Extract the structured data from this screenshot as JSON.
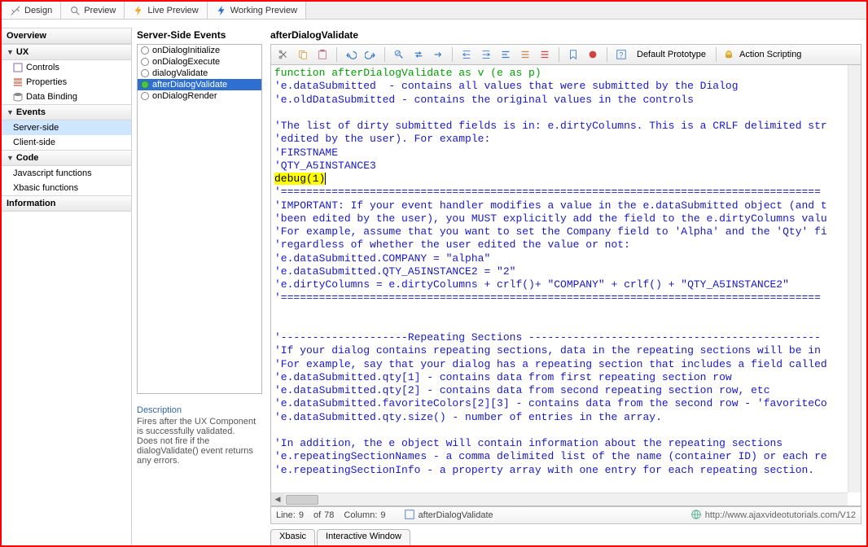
{
  "topTabs": [
    {
      "label": "Design",
      "icon": "design"
    },
    {
      "label": "Preview",
      "icon": "preview"
    },
    {
      "label": "Live Preview",
      "icon": "bolt-orange"
    },
    {
      "label": "Working Preview",
      "icon": "bolt-blue"
    }
  ],
  "leftNav": {
    "groups": [
      {
        "label": "Overview",
        "collapsible": false,
        "items": []
      },
      {
        "label": "UX",
        "collapsible": true,
        "items": [
          {
            "label": "Controls",
            "icon": "controls"
          },
          {
            "label": "Properties",
            "icon": "props"
          },
          {
            "label": "Data Binding",
            "icon": "db"
          }
        ]
      },
      {
        "label": "Events",
        "collapsible": true,
        "items": [
          {
            "label": "Server-side",
            "selected": true
          },
          {
            "label": "Client-side"
          }
        ]
      },
      {
        "label": "Code",
        "collapsible": true,
        "items": [
          {
            "label": "Javascript functions"
          },
          {
            "label": "Xbasic functions"
          }
        ]
      },
      {
        "label": "Information",
        "collapsible": false,
        "items": []
      }
    ]
  },
  "midPanel": {
    "title": "Server-Side Events",
    "events": [
      {
        "label": "onDialogInitialize",
        "defined": false
      },
      {
        "label": "onDialogExecute",
        "defined": false
      },
      {
        "label": "dialogValidate",
        "defined": false
      },
      {
        "label": "afterDialogValidate",
        "defined": true,
        "selected": true
      },
      {
        "label": "onDialogRender",
        "defined": false
      }
    ],
    "descriptionTitle": "Description",
    "descriptionBody": "Fires after the UX Component is successfully validated. Does not fire if the dialogValidate() event returns any errors."
  },
  "rightPanel": {
    "title": "afterDialogValidate",
    "toolbar": {
      "defaultProto": "Default Prototype",
      "actionScripting": "Action Scripting"
    },
    "code": {
      "fnDecl": "function afterDialogValidate as v (e as p)",
      "lines": [
        "'e.dataSubmitted  - contains all values that were submitted by the Dialog",
        "'e.oldDataSubmitted - contains the original values in the controls",
        "",
        "'The list of dirty submitted fields is in: e.dirtyColumns. This is a CRLF delimited str",
        "'edited by the user). For example:",
        "'FIRSTNAME",
        "'QTY_A5INSTANCE3"
      ],
      "highlight": "debug(1)",
      "divider": "'=====================================================================================",
      "lines2": [
        "'IMPORTANT: If your event handler modifies a value in the e.dataSubmitted object (and t",
        "'been edited by the user), you MUST explicitly add the field to the e.dirtyColumns valu",
        "'For example, assume that you want to set the Company field to 'Alpha' and the 'Qty' fi",
        "'regardless of whether the user edited the value or not:",
        "'e.dataSubmitted.COMPANY = \"alpha\"",
        "'e.dataSubmitted.QTY_A5INSTANCE2 = \"2\"",
        "'e.dirtyColumns = e.dirtyColumns + crlf()+ \"COMPANY\" + crlf() + \"QTY_A5INSTANCE2\""
      ],
      "divider2": "'=====================================================================================",
      "lines3": [
        "",
        "",
        "'--------------------Repeating Sections ----------------------------------------------",
        "'If your dialog contains repeating sections, data in the repeating sections will be in",
        "'For example, say that your dialog has a repeating section that includes a field called",
        "'e.dataSubmitted.qty[1] - contains data from first repeating section row",
        "'e.dataSubmitted.qty[2] - contains data from second repeating section row, etc",
        "'e.dataSubmitted.favoriteColors[2][3] - contains data from the second row - 'favoriteCo",
        "'e.dataSubmitted.qty.size() - number of entries in the array.",
        "",
        "'In addition, the e object will contain information about the repeating sections",
        "'e.repeatingSectionNames - a comma delimited list of the name (container ID) or each re",
        "'e.repeatingSectionInfo - a property array with one entry for each repeating section."
      ]
    },
    "status": {
      "lineLabel": "Line:",
      "lineVal": "9",
      "ofLabel": "of",
      "ofVal": "78",
      "colLabel": "Column:",
      "colVal": "9",
      "fnName": "afterDialogValidate",
      "url": "http://www.ajaxvideotutorials.com/V12"
    },
    "bottomTabs": [
      "Xbasic",
      "Interactive Window"
    ]
  }
}
